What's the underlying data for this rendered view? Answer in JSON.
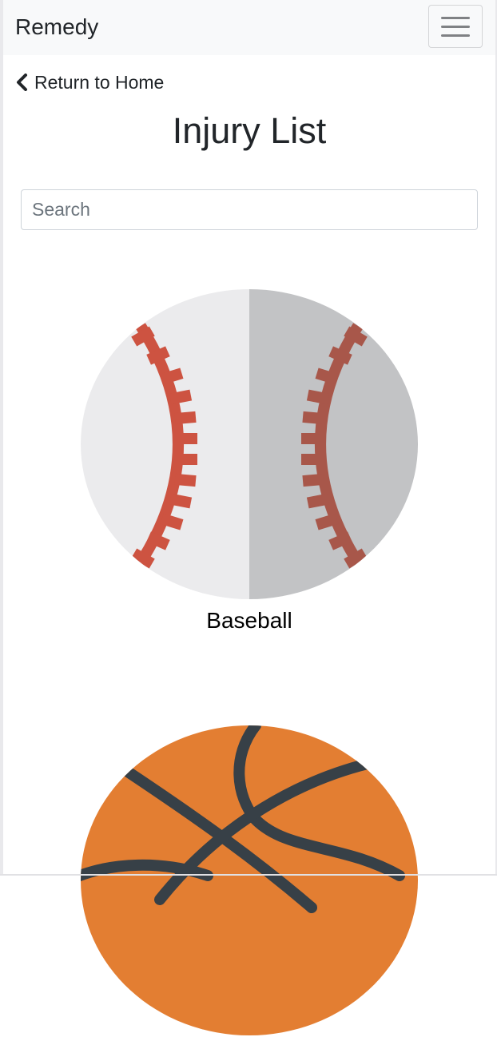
{
  "navbar": {
    "brand": "Remedy",
    "menu_icon": "hamburger-menu-icon"
  },
  "back_link": {
    "icon": "chevron-left-icon",
    "label": "Return to Home"
  },
  "page": {
    "title": "Injury List"
  },
  "search": {
    "placeholder": "Search",
    "value": ""
  },
  "sports": [
    {
      "label": "Baseball",
      "icon": "baseball-icon",
      "colors": {
        "left": "#ebebed",
        "right": "#c2c3c5",
        "stitch_left": "#cd5341",
        "stitch_right": "#a8574a"
      }
    },
    {
      "label": "",
      "icon": "basketball-icon",
      "colors": {
        "ball": "#e37e32",
        "lines": "#374047"
      }
    }
  ]
}
